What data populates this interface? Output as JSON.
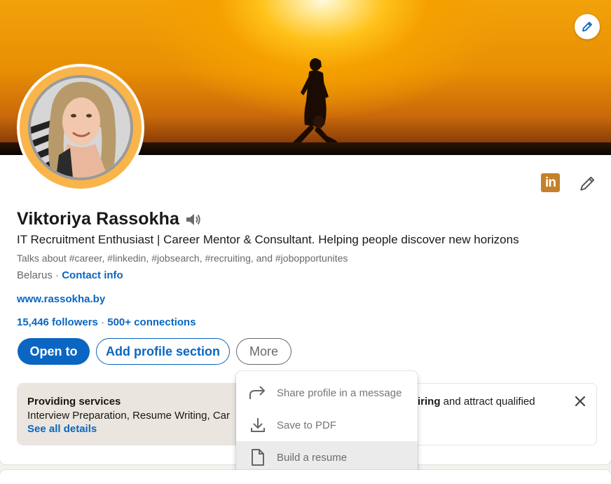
{
  "profile": {
    "name": "Viktoriya Rassokha",
    "headline": "IT Recruitment Enthusiast | Career Mentor & Consultant. Helping people discover new horizons",
    "talks_about": "Talks about #career, #linkedin, #jobsearch, #recruiting, and #jobopportunites",
    "location": "Belarus",
    "location_sep": " · ",
    "contact_info": "Contact info",
    "website": "www.rassokha.by",
    "followers": "15,446 followers",
    "network_sep": " · ",
    "connections": "500+ connections"
  },
  "badges": {
    "linkedin_logo": "in"
  },
  "actions": {
    "open_to": "Open to",
    "add_section": "Add profile section",
    "more": "More"
  },
  "services": {
    "title": "Providing services",
    "list": "Interview Preparation, Resume Writing, Car",
    "details": "See all details",
    "right_bold": "iring",
    "right_rest": " and attract qualified"
  },
  "more_menu": {
    "items": [
      {
        "label": "Share profile in a message",
        "icon": "share-arrow-icon"
      },
      {
        "label": "Save to PDF",
        "icon": "download-icon"
      },
      {
        "label": "Build a resume",
        "icon": "document-icon"
      }
    ]
  },
  "colors": {
    "primary": "#0a66c2",
    "avatar_ring": "#f9b54a",
    "services_bg": "#eae6df",
    "linkedin_badge": "#c3812b"
  }
}
